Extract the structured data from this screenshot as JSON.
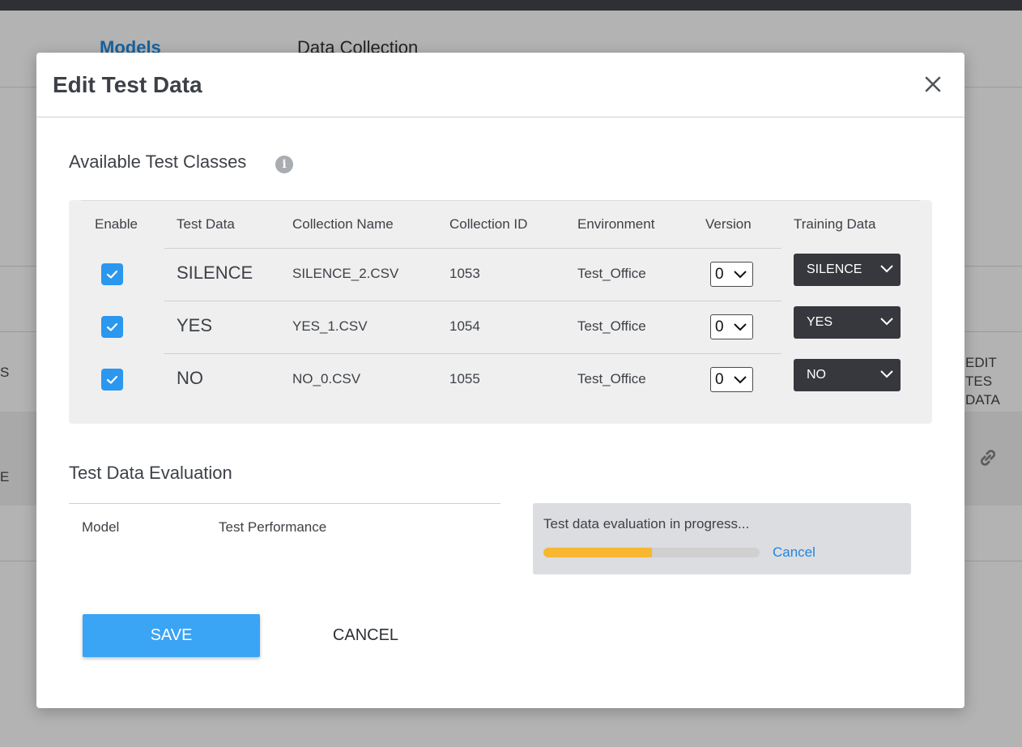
{
  "background": {
    "tabs": [
      {
        "label": "Models",
        "active": true
      },
      {
        "label": "Data Collection",
        "active": false
      }
    ],
    "edge_texts": {
      "left_mid": "S",
      "left_low": "E",
      "right_header_1": "EDIT TES",
      "right_header_2": "DATA"
    },
    "link_icon": "link-icon"
  },
  "modal": {
    "title": "Edit Test Data",
    "close_icon": "close-icon",
    "available_section": {
      "title": "Available Test Classes",
      "info_icon": "info-icon",
      "info_glyph": "i",
      "columns": [
        "Enable",
        "Test Data",
        "Collection Name",
        "Collection ID",
        "Environment",
        "Version",
        "Training Data"
      ],
      "rows": [
        {
          "enabled": true,
          "test_data": "SILENCE",
          "collection_name": "SILENCE_2.CSV",
          "collection_id": "1053",
          "environment": "Test_Office",
          "version": "0",
          "training_data": "SILENCE"
        },
        {
          "enabled": true,
          "test_data": "YES",
          "collection_name": "YES_1.CSV",
          "collection_id": "1054",
          "environment": "Test_Office",
          "version": "0",
          "training_data": "YES"
        },
        {
          "enabled": true,
          "test_data": "NO",
          "collection_name": "NO_0.CSV",
          "collection_id": "1055",
          "environment": "Test_Office",
          "version": "0",
          "training_data": "NO"
        }
      ]
    },
    "evaluation_section": {
      "title": "Test Data Evaluation",
      "columns": [
        "Model",
        "Test Performance"
      ],
      "progress_text": "Test data evaluation in progress...",
      "progress_fraction": 0.5,
      "progress_cancel_label": "Cancel"
    },
    "save_label": "SAVE",
    "cancel_label": "CANCEL"
  },
  "colors": {
    "accent": "#3aa4f5",
    "checkbox": "#2b97ee",
    "progress": "#f7b731",
    "link": "#1f86e0",
    "dark_select": "#36383d"
  }
}
